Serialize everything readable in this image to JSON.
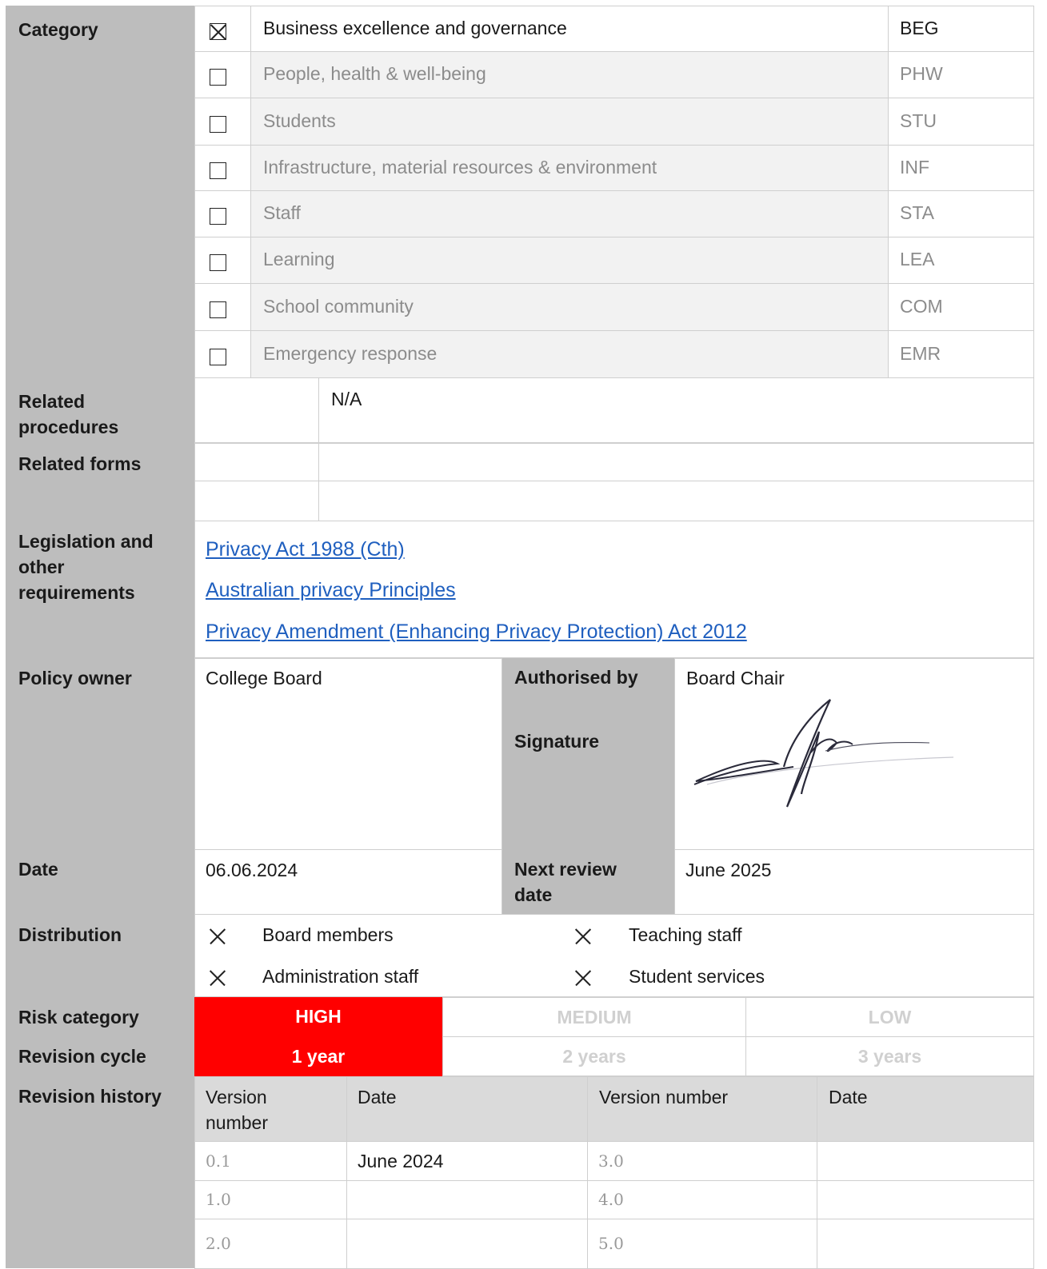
{
  "category": {
    "label": "Category",
    "items": [
      {
        "checked": true,
        "name": "Business excellence and governance",
        "code": "BEG"
      },
      {
        "checked": false,
        "name": "People, health & well-being",
        "code": "PHW"
      },
      {
        "checked": false,
        "name": "Students",
        "code": "STU"
      },
      {
        "checked": false,
        "name": "Infrastructure, material resources & environment",
        "code": "INF"
      },
      {
        "checked": false,
        "name": "Staff",
        "code": "STA"
      },
      {
        "checked": false,
        "name": "Learning",
        "code": "LEA"
      },
      {
        "checked": false,
        "name": "School community",
        "code": "COM"
      },
      {
        "checked": false,
        "name": "Emergency response",
        "code": "EMR"
      }
    ]
  },
  "related_procedures": {
    "label": "Related procedures",
    "value": "N/A"
  },
  "related_forms": {
    "label": "Related forms"
  },
  "legislation": {
    "label": "Legislation and other requirements",
    "links": [
      "Privacy Act 1988 (Cth)",
      "Australian privacy Principles",
      "Privacy Amendment (Enhancing Privacy Protection) Act 2012"
    ]
  },
  "policy_owner": {
    "label": "Policy owner",
    "value": "College Board"
  },
  "authorised_by": {
    "label": "Authorised by",
    "value": "Board Chair"
  },
  "signature": {
    "label": "Signature"
  },
  "date": {
    "label": "Date",
    "value": "06.06.2024"
  },
  "next_review": {
    "label": "Next review date",
    "value": "June 2025"
  },
  "distribution": {
    "label": "Distribution",
    "items": [
      {
        "checked": true,
        "name": "Board members"
      },
      {
        "checked": true,
        "name": "Teaching staff"
      },
      {
        "checked": true,
        "name": "Administration staff"
      },
      {
        "checked": true,
        "name": "Student services"
      }
    ]
  },
  "risk_category": {
    "label": "Risk category",
    "options": [
      "HIGH",
      "MEDIUM",
      "LOW"
    ],
    "selected": "HIGH"
  },
  "revision_cycle": {
    "label": "Revision cycle",
    "options": [
      "1 year",
      "2 years",
      "3 years"
    ],
    "selected": "1 year"
  },
  "revision_history": {
    "label": "Revision history",
    "headers": [
      "Version number",
      "Date",
      "Version number",
      "Date"
    ],
    "rows": [
      [
        "0.1",
        "June 2024",
        "3.0",
        ""
      ],
      [
        "1.0",
        "",
        "4.0",
        ""
      ],
      [
        "2.0",
        "",
        "5.0",
        ""
      ]
    ]
  },
  "colors": {
    "label_bg": "#bdbdbd",
    "selected_red": "#ff0000",
    "link_blue": "#1f5fbf"
  }
}
